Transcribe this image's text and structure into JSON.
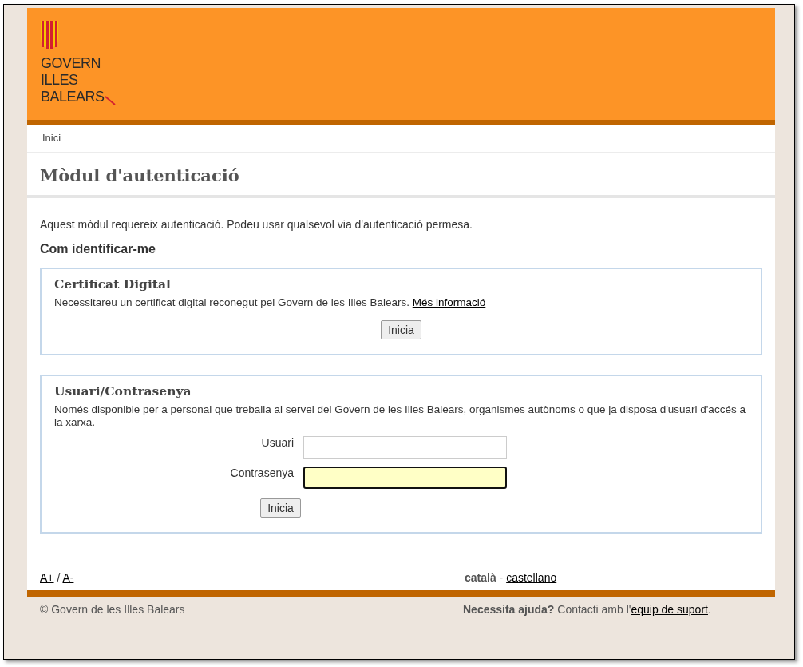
{
  "header": {
    "logo_lines": [
      "GOVERN",
      "ILLES",
      "BALEARS"
    ]
  },
  "breadcrumb": [
    {
      "label": "Inici"
    }
  ],
  "page_title": "Mòdul d'autenticació",
  "intro": "Aquest mòdul requereix autenticació. Podeu usar qualsevol via d'autenticació permesa.",
  "section_heading": "Com identificar-me",
  "methods": [
    {
      "kind": "certificate",
      "title": "Certificat Digital",
      "text": "Necessitareu un certificat digital reconegut pel Govern de les Illes Balears.",
      "link": "Més informació",
      "button": "Inicia"
    },
    {
      "kind": "login",
      "title": "Usuari/Contrasenya",
      "text": "Només disponible per a personal que treballa al servei del Govern de les Illes Balears, organismes autònoms o que ja disposa d'usuari d'accés a la xarxa.",
      "fields": [
        {
          "label": "Usuari",
          "focused": false
        },
        {
          "label": "Contrasenya",
          "focused": true
        }
      ],
      "button": "Inicia"
    }
  ],
  "font_size": {
    "increase": "A+",
    "separator": "/",
    "decrease": "A-"
  },
  "languages": [
    {
      "label": "català",
      "selected": true
    },
    {
      "label": "castellano",
      "selected": false
    }
  ],
  "language_separator": "-",
  "footer": {
    "copyright": "© Govern de les Illes Balears",
    "help_text": "**Necessita ajuda?** Contacti amb l'",
    "help_link": "equip de suport",
    "help_after": "."
  }
}
